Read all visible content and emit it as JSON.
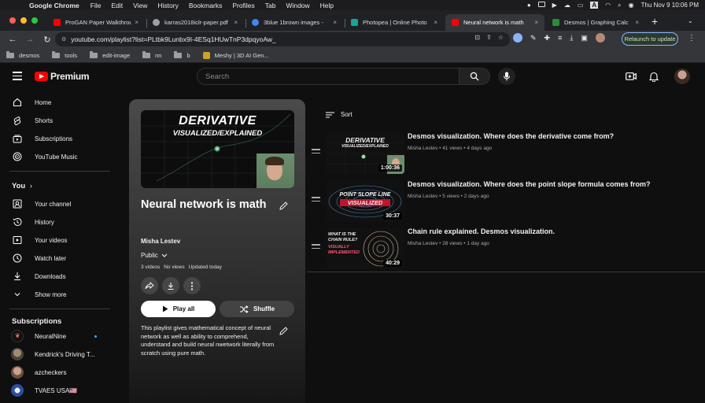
{
  "menubar": {
    "items": [
      "Google Chrome",
      "File",
      "Edit",
      "View",
      "History",
      "Bookmarks",
      "Profiles",
      "Tab",
      "Window",
      "Help"
    ],
    "datetime": "Thu Nov 9  10:06 PM"
  },
  "tabs": [
    {
      "title": "ProGAN Paper Walkthrough",
      "color": "#ff0000"
    },
    {
      "title": "karras2018iclr-paper.pdf",
      "color": "#9aa0a6"
    },
    {
      "title": "3blue 1brown images - ",
      "color": "#4285f4"
    },
    {
      "title": "Photopea | Online Photo",
      "color": "#18a497"
    },
    {
      "title": "Neural network is math",
      "color": "#ff0000"
    },
    {
      "title": "Desmos | Graphing Calc",
      "color": "#2f8a3e"
    }
  ],
  "toolbar": {
    "url": "youtube.com/playlist?list=PLtbk9Lunbx9I-4ESq1HUwTnP3dpqyoAw_",
    "relaunch": "Relaunch to update"
  },
  "bookmarks": [
    "desmos",
    "tools",
    "edit-image",
    "nn",
    "b",
    "Meshy | 3D AI Gen..."
  ],
  "header": {
    "brand": "Premium",
    "search_placeholder": "Search"
  },
  "sidebar": {
    "main": [
      {
        "label": "Home",
        "icon": "home-icon"
      },
      {
        "label": "Shorts",
        "icon": "shorts-icon"
      },
      {
        "label": "Subscriptions",
        "icon": "subscriptions-icon"
      },
      {
        "label": "YouTube Music",
        "icon": "music-icon"
      }
    ],
    "you_label": "You",
    "you": [
      {
        "label": "Your channel",
        "icon": "channel-icon"
      },
      {
        "label": "History",
        "icon": "history-icon"
      },
      {
        "label": "Your videos",
        "icon": "videos-icon"
      },
      {
        "label": "Watch later",
        "icon": "clock-icon"
      },
      {
        "label": "Downloads",
        "icon": "download-icon"
      },
      {
        "label": "Show more",
        "icon": "chevron-down-icon"
      }
    ],
    "subs_label": "Subscriptions",
    "subs": [
      {
        "label": "NeuralNine"
      },
      {
        "label": "Kendrick's Driving T..."
      },
      {
        "label": "azcheckers"
      },
      {
        "label": "TVAES USA🇺🇸"
      }
    ]
  },
  "playlist": {
    "thumb_title": "DERIVATIVE",
    "thumb_subtitle": "VISUALIZED/EXPLAINED",
    "title": "Neural network is math",
    "owner": "Misha Lestev",
    "visibility": "Public",
    "video_count": "3 videos",
    "views": "No views",
    "updated": "Updated today",
    "play_all": "Play all",
    "shuffle": "Shuffle",
    "description": "This playlist gives mathematical concept of neural network as well as ability to comprehend, understand and build neural nwetwork literally from scratch using pure math."
  },
  "list": {
    "sort_label": "Sort",
    "videos": [
      {
        "title": "Desmos visualization. Where does the derivative come from?",
        "channel": "Misha Lestev",
        "views": "41 views",
        "age": "4 days ago",
        "duration": "1:00:36",
        "thumb_line1": "DERIVATIVE",
        "thumb_line2": "VISUALIZED/EXPLAINED"
      },
      {
        "title": "Desmos visualization. Where does the point slope formula comes from?",
        "channel": "Misha Lestev",
        "views": "5 views",
        "age": "2 days ago",
        "duration": "30:37",
        "thumb_line1": "POINT SLOPE LINE",
        "thumb_line2": "VISUALIZED"
      },
      {
        "title": "Chain rule explained. Desmos visualization.",
        "channel": "Misha Lestev",
        "views": "28 views",
        "age": "1 day ago",
        "duration": "40:29",
        "thumb_line1": "WHAT IS THE CHAIN RULE?",
        "thumb_line2": "VISUALLY IMPLEMENTED"
      }
    ]
  }
}
